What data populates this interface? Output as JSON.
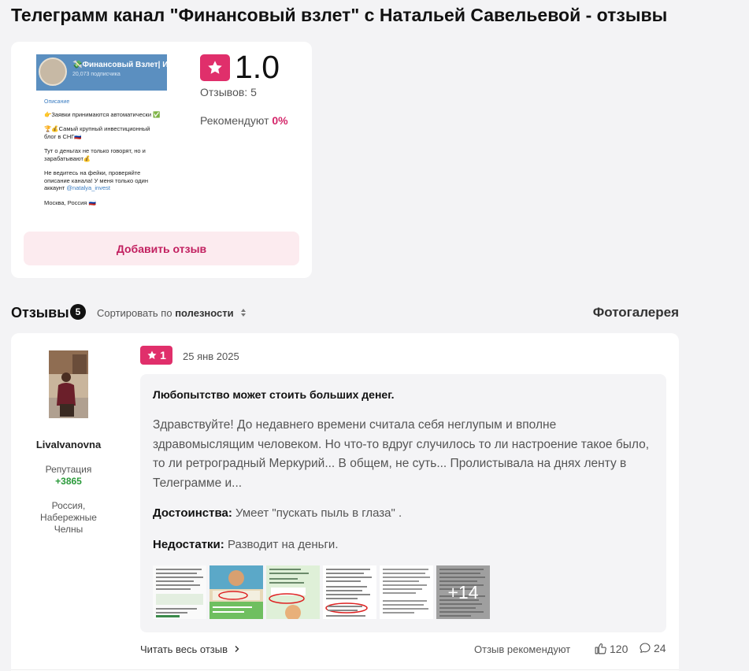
{
  "page": {
    "title": "Телеграмм канал \"Финансовый взлет\" с Натальей Савельевой - отзывы"
  },
  "summary": {
    "rating": "1.0",
    "reviews_count": "Отзывов: 5",
    "recommend_label": "Рекомендуют",
    "recommend_pct": "0%",
    "add_review": "Добавить отзыв",
    "channel_screenshot": {
      "name": "💸Финансовый Взлет| Инв",
      "subscribers": "20,073 подписчика",
      "desc_label": "Описание",
      "line1": "👉Заявки принимаются автоматически ✅",
      "line2": "🏆💰Самый крупный инвестиционный блог в СНГ🇷🇺",
      "line3": "Тут о деньгах не только говорят, но и зарабатывают💰",
      "line4": "Не ведитесь на фейки, проверяйте описание канала! У меня только один аккаунт",
      "line4_link": "@natalya_invest",
      "line5": "Москва, Россия 🇷🇺"
    },
    "colors": {
      "accent": "#e02f6b",
      "button_bg": "#fcebef"
    }
  },
  "reviews_header": {
    "label": "Отзывы",
    "count": "5",
    "sort_prefix": "Сортировать по",
    "sort_value": "полезности",
    "gallery": "Фотогалерея"
  },
  "review": {
    "author": "LivaIvanovna",
    "rep_label": "Репутация",
    "rep_value": "+3865",
    "location": "Россия, Набережные Челны",
    "rating": "1",
    "date": "25 янв 2025",
    "title": "Любопытство может стоить больших денег.",
    "text": "Здравствуйте! До недавнего времени считала себя неглупым и вполне здравомыслящим человеком. Но что-то вдруг случилось то ли настроение такое было, то ли ретроградный Меркурий... В общем, не суть... Пролистывала на днях ленту в Телеграмме и...",
    "pros_label": "Достоинства:",
    "pros": "Умеет \"пускать пыль в глаза\" .",
    "cons_label": "Недостатки:",
    "cons": "Разводит на деньги.",
    "more_photos": "+14",
    "read_more": "Читать весь отзыв",
    "recommends": "Отзыв рекомендуют",
    "likes": "120",
    "comments": "24"
  }
}
